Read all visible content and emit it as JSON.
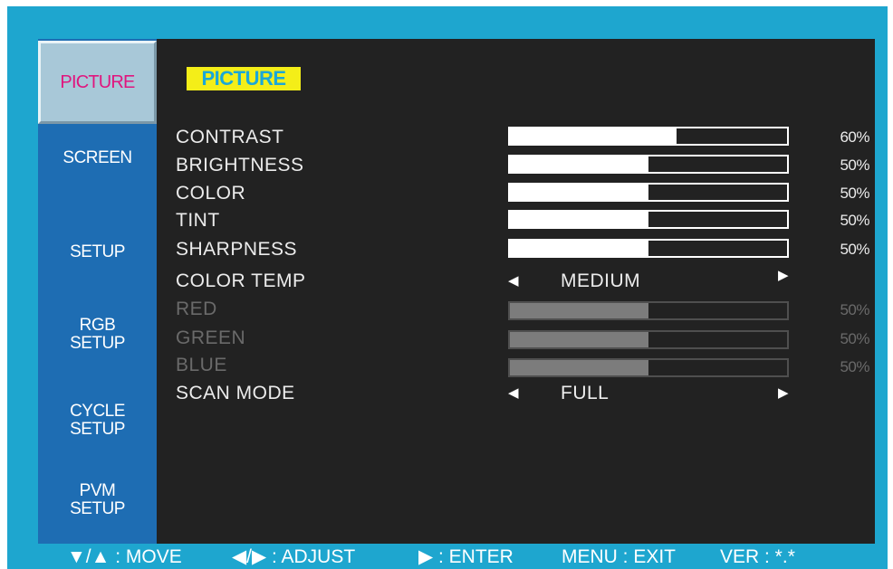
{
  "sidebar": {
    "items": [
      {
        "label": "PICTURE"
      },
      {
        "label": "SCREEN"
      },
      {
        "label": "SETUP"
      },
      {
        "label": "RGB\nSETUP"
      },
      {
        "label": "CYCLE\nSETUP"
      },
      {
        "label": "PVM\nSETUP"
      }
    ]
  },
  "panel": {
    "title": "PICTURE",
    "rows": {
      "contrast": {
        "label": "CONTRAST",
        "value": 0.6,
        "percent": "60%"
      },
      "brightness": {
        "label": "BRIGHTNESS",
        "value": 0.5,
        "percent": "50%"
      },
      "color": {
        "label": "COLOR",
        "value": 0.5,
        "percent": "50%"
      },
      "tint": {
        "label": "TINT",
        "value": 0.5,
        "percent": "50%"
      },
      "sharpness": {
        "label": "SHARPNESS",
        "value": 0.5,
        "percent": "50%"
      },
      "color_temp": {
        "label": "COLOR TEMP",
        "value": "MEDIUM"
      },
      "red": {
        "label": "RED",
        "value": 0.5,
        "percent": "50%"
      },
      "green": {
        "label": "GREEN",
        "value": 0.5,
        "percent": "50%"
      },
      "blue": {
        "label": "BLUE",
        "value": 0.5,
        "percent": "50%"
      },
      "scan_mode": {
        "label": "SCAN MODE",
        "value": "FULL"
      }
    },
    "arrow_left": "◀",
    "arrow_right": "▶"
  },
  "footer": {
    "move": "▼/▲ : MOVE",
    "adjust": "◀/▶ : ADJUST",
    "enter": "▶ : ENTER",
    "exit": "MENU : EXIT",
    "version": "VER : *.*"
  },
  "colors": {
    "frame": "#1ea6cf",
    "sidebar": "#1e6db3",
    "panel": "#222222",
    "active_tab_text": "#e0157e",
    "title_bg": "#f4ee18",
    "title_text": "#1aa7d8"
  }
}
